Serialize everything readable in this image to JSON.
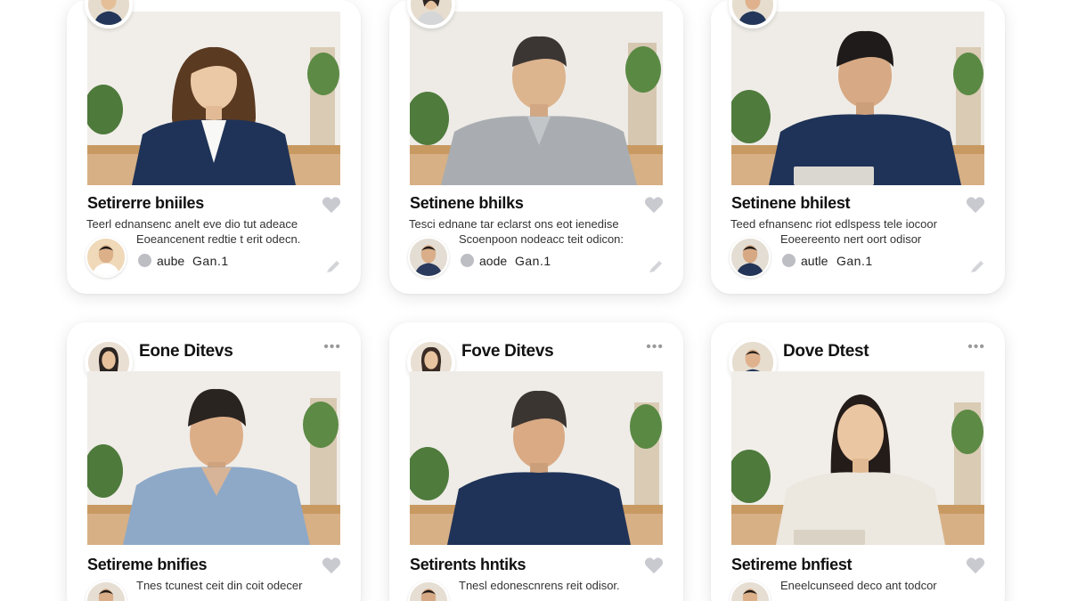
{
  "cards": [
    {
      "title": "Setirerre bniiles",
      "desc_line1": "Teerl ednansenc anelt eve dio tut adeace",
      "desc_line2": "Eoeancenent redtie t erit odecn.",
      "meta_name": "aube",
      "meta_date": "Gan.1"
    },
    {
      "title": "Setinene bhilks",
      "desc_line1": "Tesci ednane tar eclarst ons eot ienedise",
      "desc_line2": "Scoenpoon nodeacc teit odicon:",
      "meta_name": "aode",
      "meta_date": "Gan.1"
    },
    {
      "title": "Setinene bhilest",
      "desc_line1": "Teed efnansenc riot edlspess tele iocoor",
      "desc_line2": "Eoeereento nert oort odisor",
      "meta_name": "autle",
      "meta_date": "Gan.1"
    },
    {
      "header_name": "Eone Ditevs",
      "title": "Setireme bnifies",
      "desc_line1": "Tnes tcunest ceit din coit odecer"
    },
    {
      "header_name": "Fove Ditevs",
      "title": "Setirents hntiks",
      "desc_line1": "Tnesl edonescnrens reit odisor."
    },
    {
      "header_name": "Dove Dtest",
      "title": "Setireme bnfiest",
      "desc_line1": "Eneelcunseed deco ant todcor"
    }
  ],
  "icons": {
    "like": "heart-icon",
    "edit": "pencil-icon",
    "more": "more-dots-icon"
  },
  "colors": {
    "heart": "#c8cad0",
    "status_dot": "#bdbec4",
    "navy_top": "#1f3358",
    "gray_shirt": "#a9adb1",
    "blue_shirt": "#8ea9c8",
    "cream_shirt": "#ece7df"
  }
}
